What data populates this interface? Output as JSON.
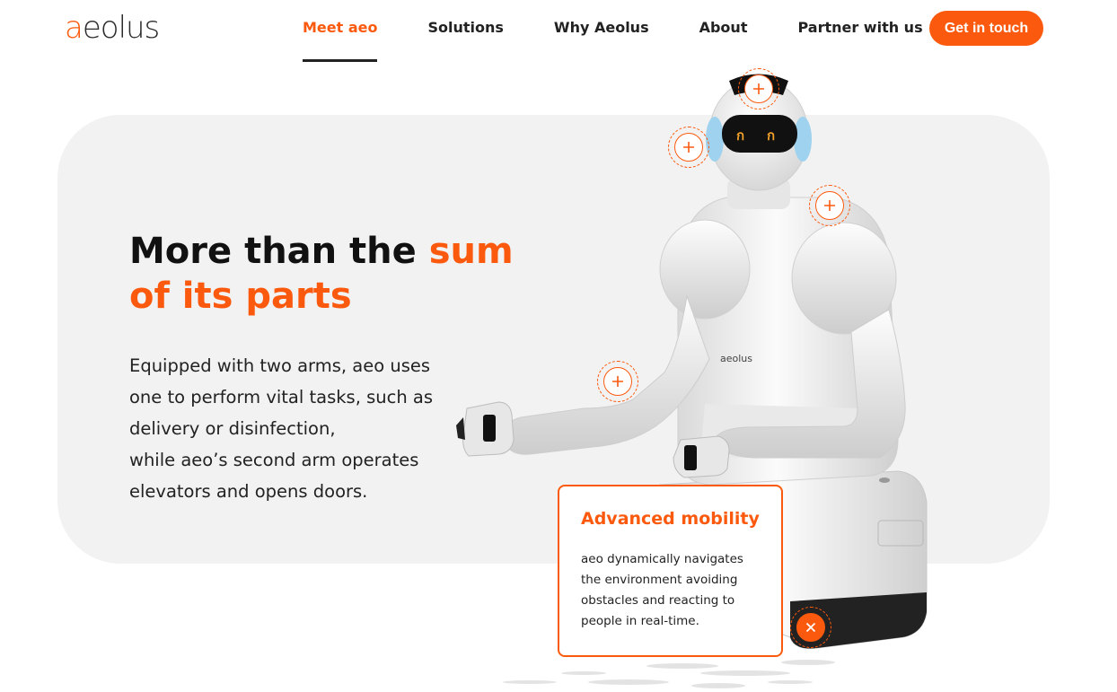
{
  "header": {
    "logo_text": "aeolus",
    "nav": [
      {
        "label": "Meet aeo",
        "active": true
      },
      {
        "label": "Solutions",
        "active": false
      },
      {
        "label": "Why Aeolus",
        "active": false
      },
      {
        "label": "About",
        "active": false
      },
      {
        "label": "Partner with us",
        "active": false
      }
    ],
    "cta_label": "Get in touch"
  },
  "hero": {
    "headline_main": "More than the ",
    "headline_accent": "sum of its parts",
    "description_line1": "Equipped with two arms, aeo uses one to perform vital tasks, such as delivery or disinfection,",
    "description_line2": "while aeo’s second arm operates elevators and opens doors."
  },
  "robot": {
    "chest_logo": "aeolus"
  },
  "popup": {
    "title": "Advanced mobility",
    "body": "aeo dynamically navigates the environment avoiding obstacles and reacting to people in real-time."
  },
  "colors": {
    "accent": "#fb5a0e",
    "card_bg": "#f2f2f2",
    "text": "#111111"
  }
}
